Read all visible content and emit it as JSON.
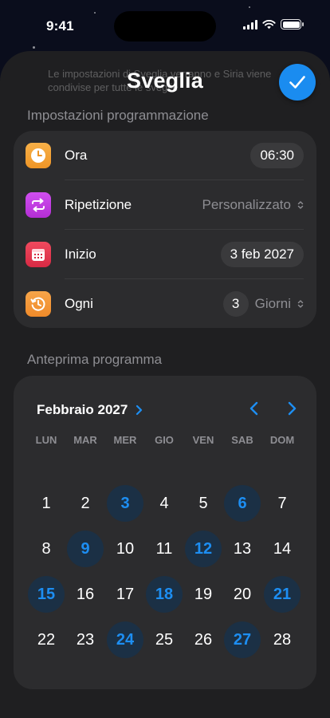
{
  "status_bar": {
    "time": "9:41"
  },
  "sheet": {
    "title": "Sveglia",
    "ghost_text": "Le impostazioni di Sveglia verranno e Siria viene condivise per tutte le sveglie",
    "done_icon": "checkmark-icon",
    "accent_color": "#1a8cf0"
  },
  "settings": {
    "header": "Impostazioni programmazione",
    "rows": [
      {
        "label": "Ora",
        "value": "06:30",
        "icon": "clock-icon",
        "color": "#f2a23a"
      },
      {
        "label": "Ripetizione",
        "value": "Personalizzato",
        "icon": "repeat-icon",
        "color": "#c43ee0"
      },
      {
        "label": "Inizio",
        "value": "3 feb 2027",
        "icon": "calendar-icon",
        "color": "#e8384f"
      },
      {
        "label": "Ogni",
        "count": "3",
        "unit": "Giorni",
        "icon": "history-icon",
        "color": "#f29436"
      }
    ]
  },
  "preview": {
    "header": "Anteprima programma",
    "month": "Febbraio 2027",
    "weekdays": [
      "LUN",
      "MAR",
      "MER",
      "GIO",
      "VEN",
      "SAB",
      "DOM"
    ],
    "weeks": [
      [
        "1",
        "2",
        "3",
        "4",
        "5",
        "6",
        "7"
      ],
      [
        "8",
        "9",
        "10",
        "11",
        "12",
        "13",
        "14"
      ],
      [
        "15",
        "16",
        "17",
        "18",
        "19",
        "20",
        "21"
      ],
      [
        "22",
        "23",
        "24",
        "25",
        "26",
        "27",
        "28"
      ]
    ],
    "selected_days": [
      "3",
      "6",
      "9",
      "12",
      "15",
      "18",
      "21",
      "24",
      "27"
    ]
  }
}
